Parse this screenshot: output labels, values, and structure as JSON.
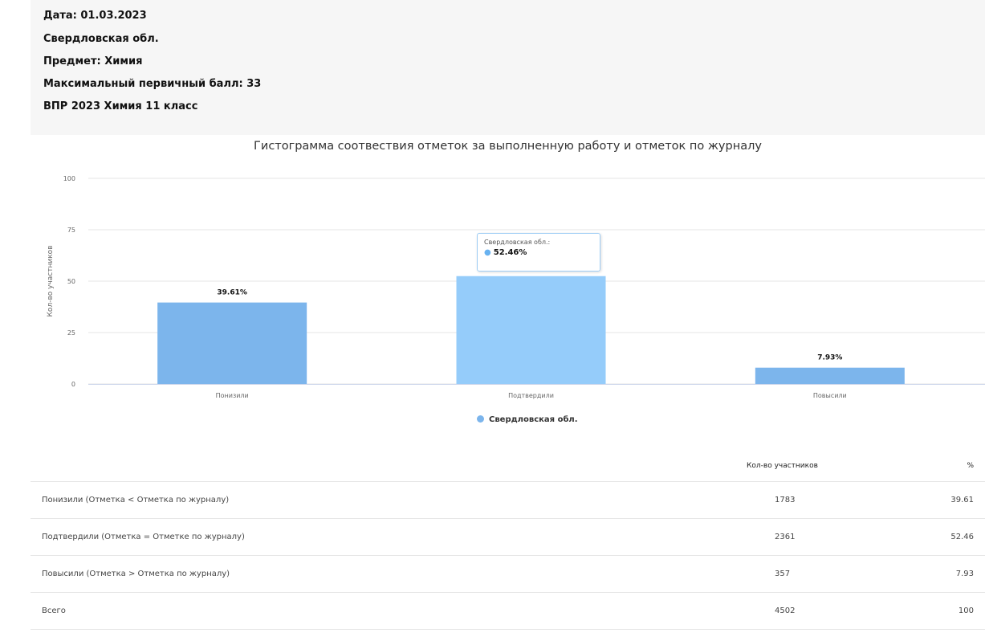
{
  "header": {
    "date": "Дата: 01.03.2023",
    "region": "Свердловская обл.",
    "subject": "Предмет: Химия",
    "max_score": "Максимальный первичный балл: 33",
    "test": "ВПР 2023 Химия 11 класс"
  },
  "chart_data": {
    "type": "bar",
    "title": "Гистограмма соотвествия отметок за выполненную работу и отметок по журналу",
    "ylabel": "Кол-во участников",
    "xlabel": "",
    "ylim": [
      0,
      100
    ],
    "yticks": [
      "0",
      "25",
      "50",
      "75",
      "100"
    ],
    "categories": [
      "Понизили",
      "Подтвердили",
      "Повысили"
    ],
    "series": [
      {
        "name": "Свердловская обл.",
        "values": [
          39.61,
          52.46,
          7.93
        ],
        "data_labels": [
          "39.61%",
          "",
          "7.93%"
        ]
      }
    ],
    "colors": {
      "bar": "#7cb5ec",
      "bar_hover": "#95ccfa"
    },
    "grid": true,
    "legend": "bottom-center",
    "tooltip": {
      "name": "Свердловская обл.:",
      "value": "52.46%"
    }
  },
  "table": {
    "headers": [
      "",
      "Кол-во участников",
      "%"
    ],
    "rows": [
      [
        "Понизили (Отметка < Отметка по журналу)",
        "1783",
        "39.61"
      ],
      [
        "Подтвердили (Отметка = Отметке по журналу)",
        "2361",
        "52.46"
      ],
      [
        "Повысили (Отметка > Отметка по журналу)",
        "357",
        "7.93"
      ],
      [
        "Всего",
        "4502",
        "100"
      ]
    ]
  }
}
